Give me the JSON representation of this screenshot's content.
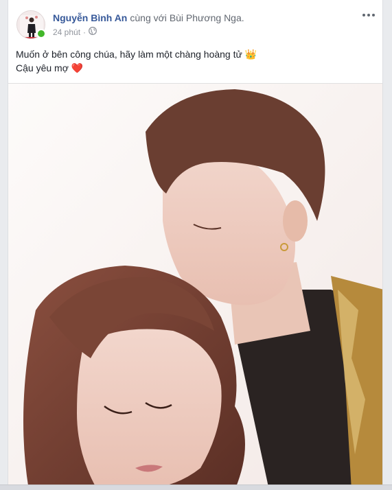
{
  "post": {
    "author": "Nguyễn Bình An",
    "with_text": "cùng với",
    "tagged": "Bùi Phương Nga.",
    "time": "24 phút",
    "separator": "·",
    "privacy_icon": "globe-icon",
    "options_icon": "more-options-icon",
    "text_line1": "Muốn ở bên công chúa, hãy làm một chàng hoàng tử",
    "emoji_crown": "👑",
    "text_line2": "Cậu yêu mợ",
    "emoji_heart": "❤️",
    "photo": "couple-photo"
  },
  "colors": {
    "link": "#365899",
    "secondary": "#616770",
    "meta": "#90949c",
    "online": "#42b72a"
  }
}
